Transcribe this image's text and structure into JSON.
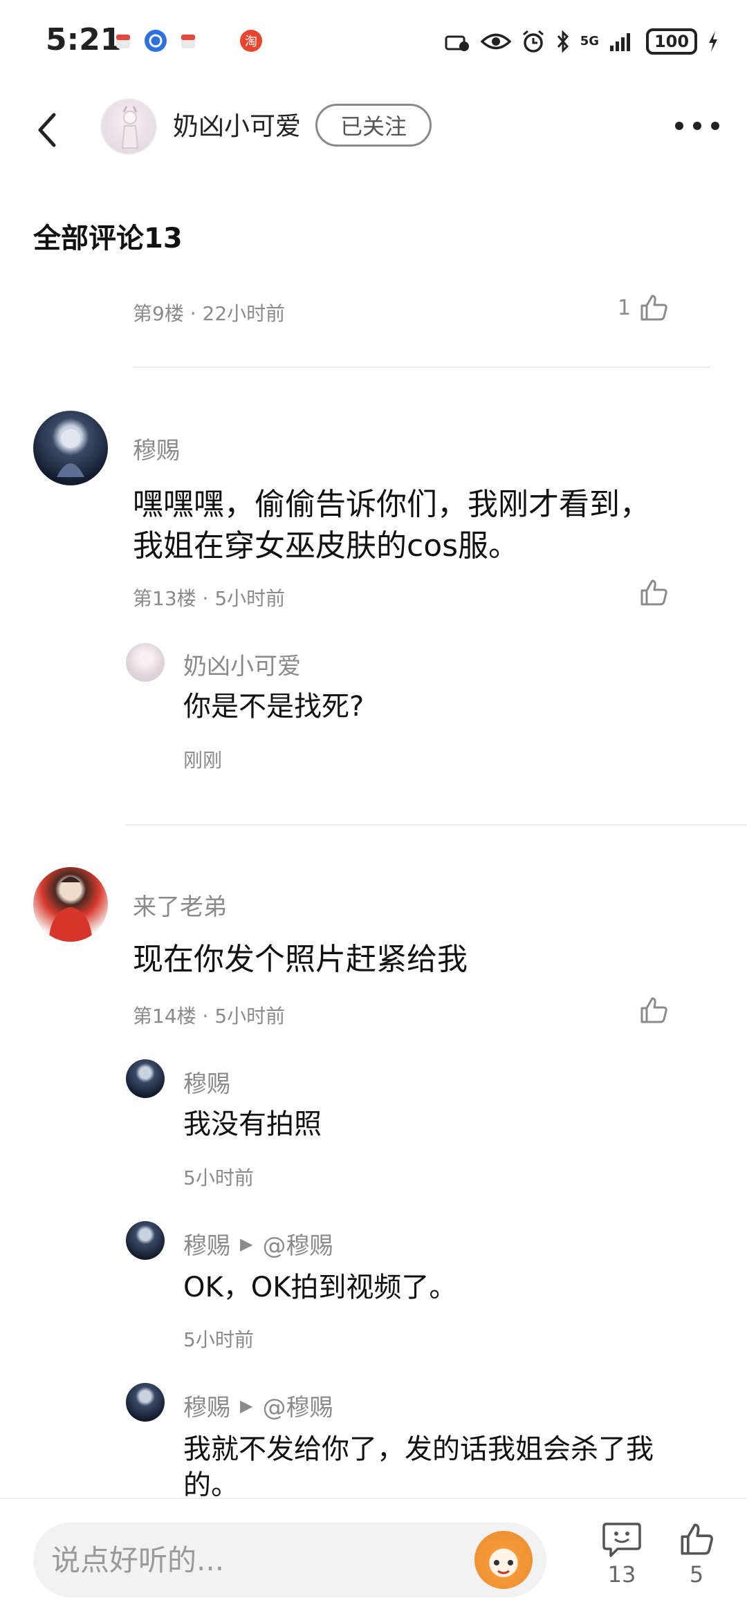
{
  "status_bar": {
    "time": "5:21",
    "network": "5G",
    "battery": "100"
  },
  "header": {
    "user_name": "奶凶小可爱",
    "follow_label": "已关注"
  },
  "section_title": "全部评论13",
  "comments": [
    {
      "floor_meta": "第9楼 · 22小时前",
      "like_count": "1"
    },
    {
      "name": "穆赐",
      "content": "嘿嘿嘿，偷偷告诉你们，我刚才看到，我姐在穿女巫皮肤的cos服。",
      "floor_meta": "第13楼 · 5小时前",
      "replies": [
        {
          "name": "奶凶小可爱",
          "content": "你是不是找死?",
          "time": "刚刚"
        }
      ]
    },
    {
      "name": "来了老弟",
      "content": "现在你发个照片赶紧给我",
      "floor_meta": "第14楼 · 5小时前",
      "replies": [
        {
          "name": "穆赐",
          "content": "我没有拍照",
          "time": "5小时前"
        },
        {
          "name": "穆赐",
          "reply_to": "@穆赐",
          "content": "OK，OK拍到视频了。",
          "time": "5小时前"
        },
        {
          "name": "穆赐",
          "reply_to": "@穆赐",
          "content": "我就不发给你了，发的话我姐会杀了我的。"
        }
      ]
    }
  ],
  "bottom_bar": {
    "input_placeholder": "说点好听的...",
    "comment_count": "13",
    "like_count": "5"
  },
  "colors": {
    "text_primary": "#111111",
    "text_secondary": "#8a8a8a",
    "divider": "#ececec",
    "input_bg": "#f2f2f2"
  }
}
